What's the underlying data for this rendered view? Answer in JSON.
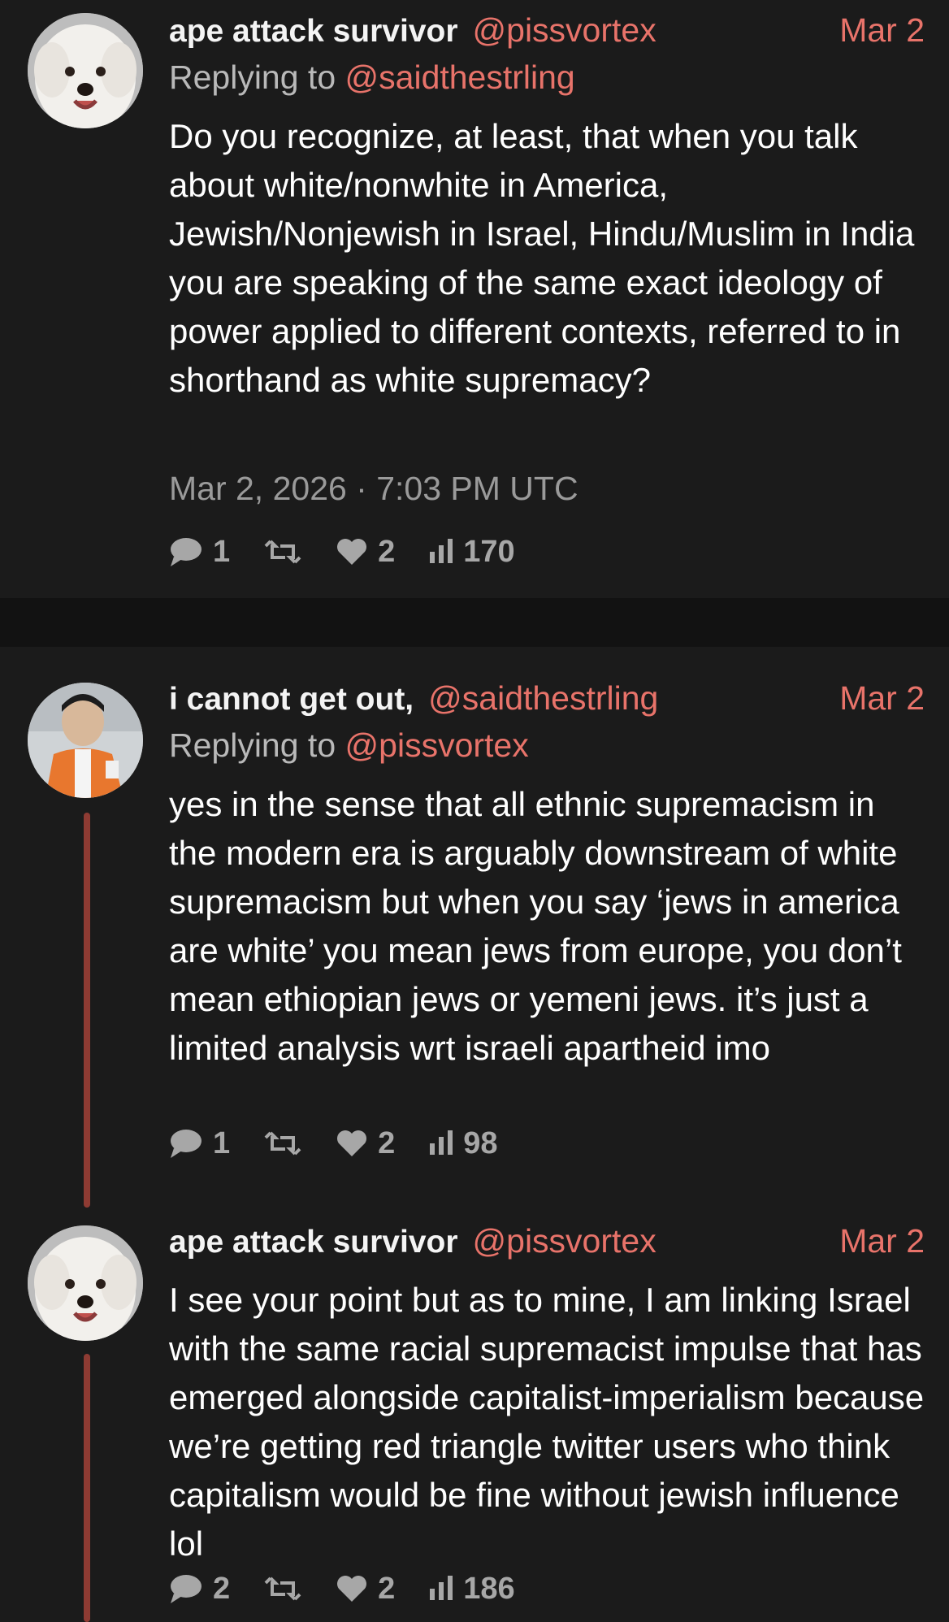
{
  "colors": {
    "background": "#181818",
    "separator": "#121212",
    "accent": "#e8736a",
    "thread_line": "#8e3b33"
  },
  "tweets": [
    {
      "name": "ape attack survivor",
      "handle": "@pissvortex",
      "date": "Mar 2",
      "reply_prefix": "Replying to",
      "reply_to": "@saidthestrling",
      "text": "Do you recognize, at least, that when you talk about white/nonwhite in America, Jewish/Nonjewish in Israel, Hindu/Muslim in India you are speaking of the same exact ideology of power applied to different contexts, referred to in shorthand as white supremacy?",
      "timestamp": "Mar 2, 2026 · 7:03 PM UTC",
      "stats": {
        "replies": "1",
        "retweets": "",
        "likes": "2",
        "views": "170"
      },
      "avatar_icon": "white-dog-avatar"
    },
    {
      "name": "i cannot get out,",
      "handle": "@saidthestrling",
      "date": "Mar 2",
      "reply_prefix": "Replying to",
      "reply_to": "@pissvortex",
      "text": "yes in the sense that all ethnic supremacism in the modern era is arguably downstream of white supremacism but when you say ‘jews in america are white’ you mean jews from europe, you don’t mean ethiopian jews or yemeni jews. it’s just a limited analysis wrt israeli apartheid imo",
      "stats": {
        "replies": "1",
        "retweets": "",
        "likes": "2",
        "views": "98"
      },
      "avatar_icon": "man-orange-vest-avatar"
    },
    {
      "name": "ape attack survivor",
      "handle": "@pissvortex",
      "date": "Mar 2",
      "text": "I see your point but as to mine, I am linking Israel with the same racial supremacist impulse that has emerged alongside capitalist-imperialism because we’re getting red triangle twitter users who think capitalism would be fine without jewish influence lol",
      "stats": {
        "replies": "2",
        "retweets": "",
        "likes": "2",
        "views": "186"
      },
      "avatar_icon": "white-dog-avatar"
    }
  ]
}
